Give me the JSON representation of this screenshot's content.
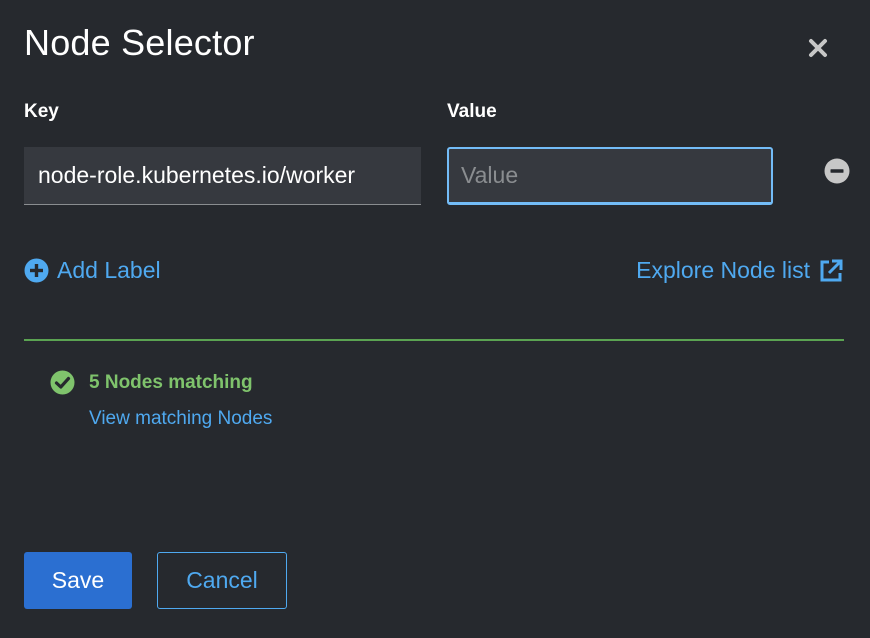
{
  "dialog": {
    "title": "Node Selector",
    "close_icon": "close-icon"
  },
  "fields": {
    "key_label": "Key",
    "value_label": "Value",
    "rows": [
      {
        "key": "node-role.kubernetes.io/worker",
        "value": "",
        "value_placeholder": "Value"
      }
    ],
    "remove_icon": "minus-circle-icon"
  },
  "actions": {
    "add_label": "Add Label",
    "add_icon": "plus-circle-icon",
    "explore_link": "Explore Node list",
    "explore_icon": "external-link-icon"
  },
  "match": {
    "status_text": "5 Nodes matching",
    "status_icon": "check-circle-icon",
    "view_link": "View matching Nodes"
  },
  "footer": {
    "save_label": "Save",
    "cancel_label": "Cancel"
  },
  "colors": {
    "background": "#26292e",
    "link": "#4fa9f0",
    "success": "#7fc36c",
    "primary": "#2b6fd1"
  }
}
